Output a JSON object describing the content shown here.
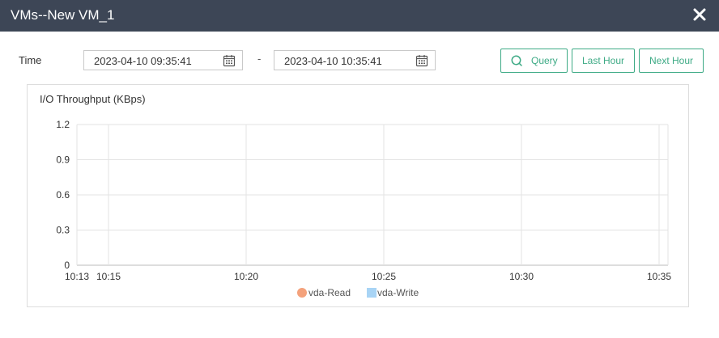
{
  "dialog": {
    "title": "VMs--New VM_1"
  },
  "filters": {
    "time_label": "Time",
    "start": "2023-04-10 09:35:41",
    "separator": "-",
    "end": "2023-04-10 10:35:41",
    "query_label": "Query",
    "last_hour_label": "Last Hour",
    "next_hour_label": "Next Hour"
  },
  "colors": {
    "accent": "#3daa85",
    "titlebar": "#3d4656",
    "read": "#f4a27c",
    "write": "#a8d4f5"
  },
  "chart_data": {
    "type": "line",
    "title": "I/O Throughput (KBps)",
    "xlabel": "",
    "ylabel": "",
    "x_ticks": [
      "10:13",
      "10:15",
      "10:20",
      "10:25",
      "10:30",
      "10:35"
    ],
    "y_ticks": [
      "0",
      "0.3",
      "0.6",
      "0.9",
      "1.2"
    ],
    "ylim": [
      0,
      1.2
    ],
    "grid": true,
    "legend_position": "bottom",
    "series": [
      {
        "name": "vda-Read",
        "values": [],
        "color": "#f4a27c",
        "marker": "circle"
      },
      {
        "name": "vda-Write",
        "values": [],
        "color": "#a8d4f5",
        "marker": "square"
      }
    ]
  }
}
